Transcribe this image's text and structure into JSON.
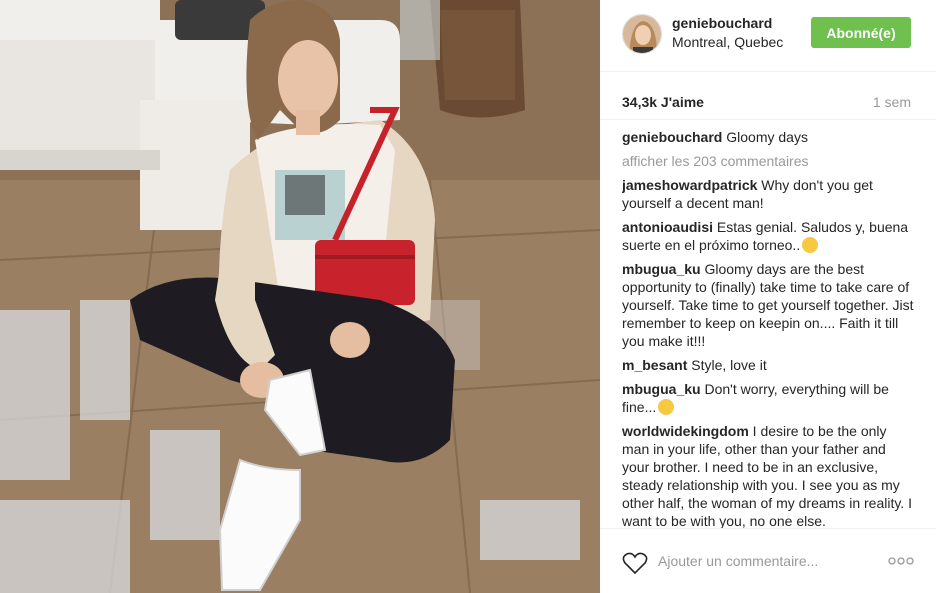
{
  "post": {
    "photo_alt": "icon"
  },
  "header": {
    "username": "geniebouchard",
    "location": "Montreal, Quebec",
    "follow_label": "Abonné(e)"
  },
  "stats": {
    "likes": "34,3k J'aime",
    "time": "1 sem"
  },
  "caption": {
    "user": "geniebouchard",
    "text": "Gloomy days"
  },
  "view_more": "afficher les 203 commentaires",
  "comments": [
    {
      "user": "jameshowardpatrick",
      "text": "Why don't you get yourself a decent man!"
    },
    {
      "user": "antonioaudisi",
      "text": "Estas genial. Saludos y, buena suerte en el próximo torneo.."
    },
    {
      "user": "mbugua_ku",
      "text": "Gloomy days are the best opportunity to (finally) take time to take care of yourself. Take time to get yourself together. Jist remember to keep on keepin on.... Faith it till you make it!!!"
    },
    {
      "user": "m_besant",
      "text": "Style, love it"
    },
    {
      "user": "mbugua_ku",
      "text": "Don't worry, everything will be fine..."
    },
    {
      "user": "worldwidekingdom",
      "text": "I desire to be the only man in your life, other than your father and your brother. I need to be in an exclusive, steady relationship with you. I see you as my other half, the woman of my dreams in reality. I want to be with you, no one else."
    }
  ],
  "footer": {
    "placeholder": "Ajouter un commentaire...",
    "like_icon": "heart-outline-icon",
    "options_icon": "more-options-icon"
  },
  "colors": {
    "follow_green": "#70c050",
    "muted": "#999999",
    "text": "#262626"
  }
}
